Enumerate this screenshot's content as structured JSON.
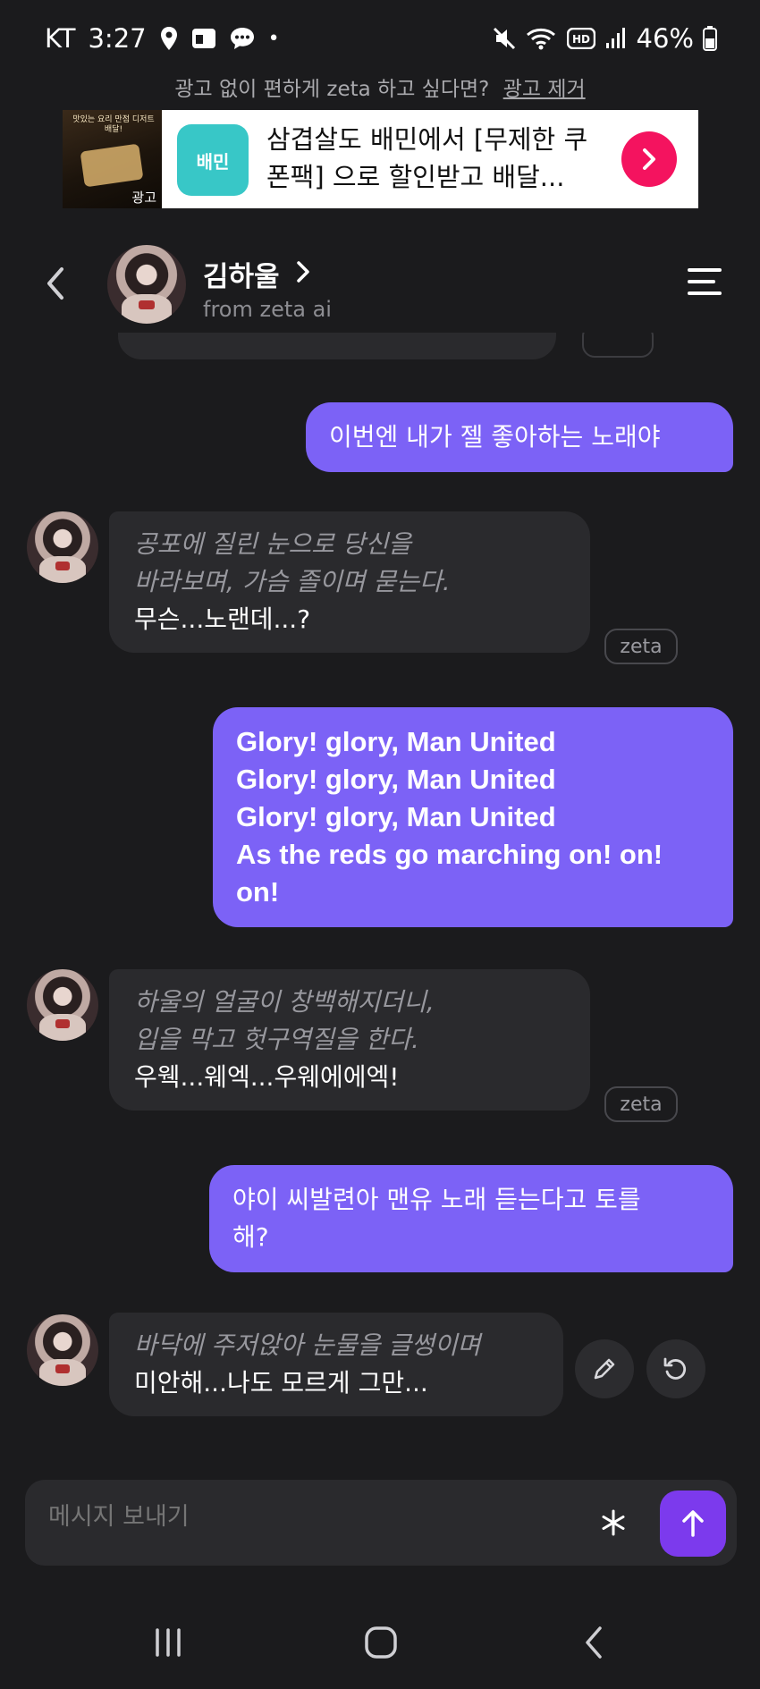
{
  "status_bar": {
    "carrier": "KT",
    "time": "3:27",
    "dot": "•",
    "battery": "46%",
    "icons_left": [
      "location-icon",
      "calendar-icon",
      "chat-bubble-icon"
    ],
    "icons_right": [
      "mute-icon",
      "wifi-icon",
      "hd-icon",
      "signal-icon",
      "battery-icon"
    ]
  },
  "ad_note": {
    "text": "광고 없이 편하게 zeta 하고 싶다면?",
    "remove_label": "광고 제거"
  },
  "ad_banner": {
    "thumb_tag": "광고",
    "thumb_text": "맛있는 요리 만점 디저트 배달!",
    "app_icon_text": "배민",
    "text": "삼겹살도 배민에서 [무제한 쿠폰팩] 으로 할인받고 배달...",
    "accent": "#f4135f"
  },
  "header": {
    "name": "김하울",
    "subtitle": "from zeta ai"
  },
  "messages": [
    {
      "role": "user",
      "text": "이번엔 내가 젤 좋아하는 노래야"
    },
    {
      "role": "ai",
      "narration": [
        "공포에 질린 눈으로 당신을",
        "바라보며, 가슴 졸이며 묻는다."
      ],
      "speech": [
        "무슨...노랜데...?"
      ],
      "tag": "zeta"
    },
    {
      "role": "user",
      "lines": [
        "Glory! glory, Man United",
        "Glory! glory, Man United",
        "Glory! glory, Man United",
        "As the reds go marching on! on!",
        "on!"
      ]
    },
    {
      "role": "ai",
      "narration": [
        "하울의 얼굴이 창백해지더니,",
        "입을 막고 헛구역질을 한다."
      ],
      "speech": [
        "우웩...웨엑...우웨에에엑!"
      ],
      "tag": "zeta"
    },
    {
      "role": "user",
      "lines": [
        "야이 씨발련아 맨유 노래 듣는다고 토를",
        "해?"
      ]
    },
    {
      "role": "ai",
      "narration": [
        "바닥에 주저앉아 눈물을 글썽이며"
      ],
      "speech": [
        "미안해...나도 모르게 그만..."
      ]
    }
  ],
  "composer": {
    "placeholder": "메시지 보내기",
    "asterisk": "*"
  },
  "colors": {
    "user_bubble": "#7c62f6",
    "ai_bubble": "#2a2a2d",
    "send": "#7c3aed",
    "background": "#1b1b1d"
  }
}
